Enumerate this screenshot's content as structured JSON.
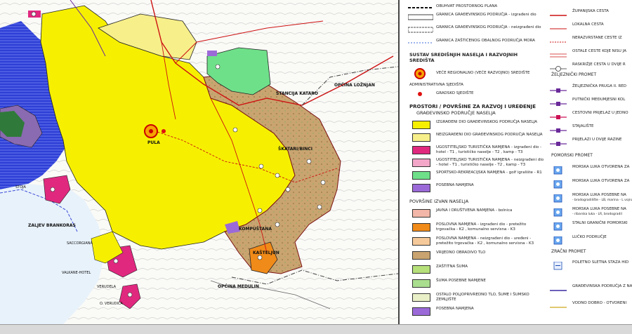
{
  "map": {
    "labels": {
      "pula": "PULA",
      "stancija_kataro": "STANCIJA KATARO",
      "opcina_loznjan": "OPĆINA LOŽNJAN",
      "skatari": "ŠKATARI/BINCI",
      "kompustana": "KOMPUŠTANA",
      "kasteljun": "KAŠTELJUN",
      "opcina_medulin": "OPĆINA MEDULIN",
      "zaljev_brankoras": "ZALJEV BRANKORAS",
      "stoja": "STOJA",
      "saccorgiana": "SACCORGIANA",
      "valkane": "VALKANE-HOTEL",
      "verudela": "VERUDELA",
      "verudica": "O. VERUDICA"
    },
    "colors": {
      "sea": "#2e3fd6",
      "built": "#f6f000",
      "unbuilt": "#f7ef8a",
      "agri": "#c9a470",
      "sport": "#6fe08a",
      "tourist": "#e0287f",
      "business": "#f08a18",
      "special": "#9b6ad8"
    }
  },
  "legend_top": [
    {
      "icon": "line-dashed-black",
      "label": "OBUHVAT PROSTORNOG PLANA"
    },
    {
      "icon": "line-double",
      "label": "GRANICA GRAĐEVINSKOG PODRUČJA - izgrađeni dio"
    },
    {
      "icon": "line-double-dashed",
      "label": "GRANICA GRAĐEVINSKOG PODRUČJA - neizgrađeni dio"
    },
    {
      "icon": "line-dotted-blue",
      "label": "GRANICA ZAŠTIĆENOG OBALNOG PODRUČJA MORA"
    }
  ],
  "settlements": {
    "header": "SUSTAV SREDIŠNJIH NASELJA I RAZVOJNIH SREDIŠTA",
    "items": [
      {
        "icon": "regional-centre-icon",
        "label": "VEĆE REGIONALNO (VEĆE RAZVOJNO) SREDIŠTE"
      },
      {
        "icon": "admin-seat-icon",
        "label": "ADMINISTRATIVNA SJEDIŠTA"
      },
      {
        "icon": "city-seat-icon",
        "label": "GRADSKO SJEDIŠTE"
      }
    ]
  },
  "zones": {
    "header1": "PROSTORI / POVRŠINE ZA RAZVOJ I UREĐENJE",
    "header2": "GRAĐEVINSKO PODRUČJE NASELJA",
    "items": [
      {
        "color": "#f6f000",
        "label": "IZGRAĐENI DIO GRAĐEVINSKOG PODRUČJA NASELJA"
      },
      {
        "color": "#f7ef8a",
        "label": "NEIZGRAĐENI DIO GRAĐEVINSKOG PODRUČJA NASELJA"
      },
      {
        "color": "#e0287f",
        "label": "UGOSTITELJSKO TURISTIČKA NAMJENA - izgrađeni dio - hotel - T1 , turističko naselje - T2 , kamp - T3"
      },
      {
        "color": "#f3a6c8",
        "label": "UGOSTITELJSKO TURISTIČKA NAMJENA - neizgrađeni dio - hotel - T1 , turističko naselje - T2 , kamp - T3"
      },
      {
        "color": "#6fe08a",
        "label": "SPORTSKO-REKREACIJSKA NAMJENA - golf igralište - R1"
      },
      {
        "color": "#9b6ad8",
        "label": "POSEBNA NAMJENA"
      }
    ],
    "header3": "POVRŠINE IZVAN NASELJA",
    "items2": [
      {
        "color": "#f2b7a8",
        "label": "JAVNA I DRUŠTVENA NAMJENA - bolnica"
      },
      {
        "color": "#f08a18",
        "label": "POSLOVNA NAMJENA - izgrađeni dio - pretežito trgovačka - K2 , komunalno servisna - K3"
      },
      {
        "color": "#f6c99a",
        "label": "POSLOVNA NAMJENA - neizgrađeni dio - uređeni - pretežito trgovačka - K2 , komunalno servisna - K3"
      },
      {
        "color": "#c9a470",
        "label": "VRIJEDNO OBRADIVO TLO"
      },
      {
        "color": "#b6e07a",
        "label": "ZAŠTITNA ŠUMA"
      },
      {
        "color": "#a9de8f",
        "label": "ŠUMA POSEBNE NAMJENE"
      },
      {
        "color": "#e9f0c8",
        "label": "OSTALO POLJOPRIVREDNO TLO, ŠUME I ŠUMSKO ZEMLJIŠTE"
      },
      {
        "color": "#9b6ad8",
        "label": "POSEBNA NAMJENA"
      }
    ]
  },
  "roads": {
    "items": [
      {
        "color": "#cc1111",
        "style": "solid",
        "label": "ŽUPANIJSKA CESTA"
      },
      {
        "color": "#cc1111",
        "style": "thin",
        "label": "LOKALNA CESTA"
      },
      {
        "color": "#cc1111",
        "style": "dotted",
        "label": "NERAZVRSTANE CESTE IZ"
      },
      {
        "color": "#cc1111",
        "style": "double",
        "label": "OSTALE CESTE KOJE NISU JA"
      },
      {
        "color": "#333333",
        "style": "junction",
        "label": "RASKRIŽJE CESTA U DVIJE R"
      }
    ],
    "rail_header": "ŽELJEZNIČKI PROMET",
    "rail": [
      {
        "color": "#6a2a9a",
        "label": "ŽELJEZNIČKA PRUGA II. RED"
      },
      {
        "color": "#6a2a9a",
        "label": "PUTNIČKI MEĐUMJESNI KOL"
      },
      {
        "color": "#cc1155",
        "label": "CESTOVNI PRIJELAZ U JEDNO"
      },
      {
        "color": "#6a2a9a",
        "label": "STAJALIŠTE"
      },
      {
        "color": "#6a2a9a",
        "label": "PRIJELAZI U DVIJE RAZINE"
      }
    ],
    "sea_header": "POMORSKI PROMET",
    "sea": [
      {
        "label": "MORSKA LUKA OTVORENA ZA"
      },
      {
        "label": "MORSKA LUKA OTVORENA ZA"
      },
      {
        "label": "MORSKA LUKA POSEBNE NA",
        "sub": "- brodogradilište - LB, marina - L vojna luka - LV, industrijska - L"
      },
      {
        "label": "MORSKA LUKA POSEBNE NA",
        "sub": "- ribarska luka - LR, brodogradil"
      },
      {
        "label": "STALNI GRANIČNI POMORSKI"
      },
      {
        "label": "LUČKO PODRUČJE"
      }
    ],
    "air_header": "ZRAČNI PROMET",
    "air": [
      {
        "label": "POLETNO SLETNA STAZA HID"
      }
    ],
    "misc": [
      {
        "color": "#3a2aa0",
        "label": "GRAĐEVINSKA PODRUČJA Z NASELJA PLANIRANA ZA UR"
      },
      {
        "color": "#d7b740",
        "label": "VODNO DOBRO - OTVORENI"
      }
    ]
  }
}
